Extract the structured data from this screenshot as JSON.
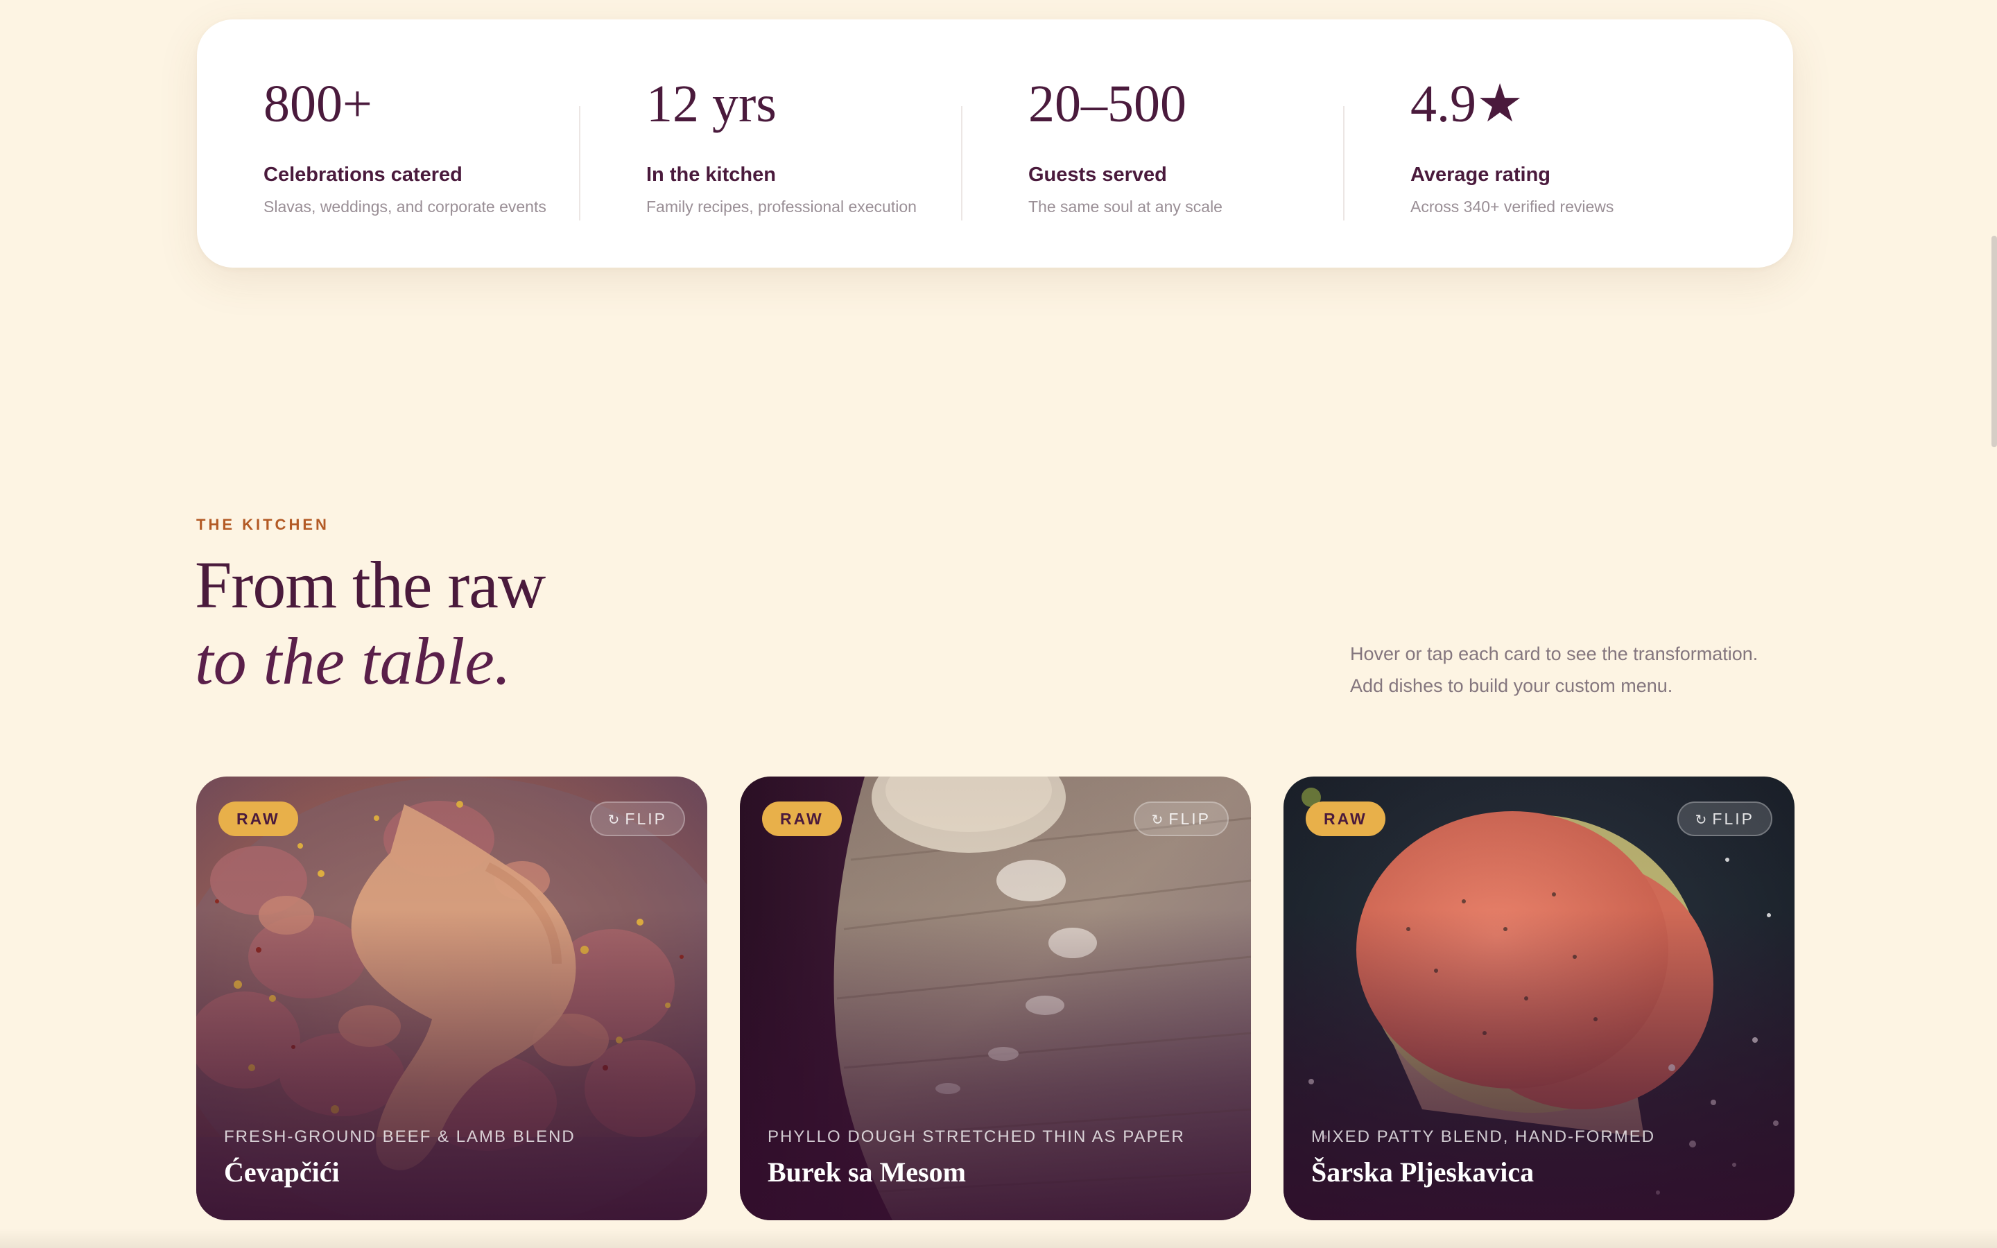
{
  "stats": [
    {
      "value": "800+",
      "label": "Celebrations catered",
      "desc": "Slavas, weddings, and corporate events"
    },
    {
      "value": "12 yrs",
      "label": "In the kitchen",
      "desc": "Family recipes, professional execution"
    },
    {
      "value": "20–500",
      "label": "Guests served",
      "desc": "The same soul at any scale"
    },
    {
      "value": "4.9★",
      "label": "Average rating",
      "desc": "Across 340+ verified reviews"
    }
  ],
  "section": {
    "eyebrow": "THE KITCHEN",
    "title_line1": "From the raw",
    "title_line2": "to the table.",
    "intro_line1": "Hover or tap each card to see the transformation.",
    "intro_line2": "Add dishes to build your custom menu."
  },
  "cards": [
    {
      "badge": "RAW",
      "flip_icon": "↻",
      "flip_label": "FLIP",
      "subtitle": "FRESH-GROUND BEEF & LAMB BLEND",
      "name": "Ćevapčići"
    },
    {
      "badge": "RAW",
      "flip_icon": "↻",
      "flip_label": "FLIP",
      "subtitle": "PHYLLO DOUGH STRETCHED THIN AS PAPER",
      "name": "Burek sa Mesom"
    },
    {
      "badge": "RAW",
      "flip_icon": "↻",
      "flip_label": "FLIP",
      "subtitle": "MIXED PATTY BLEND, HAND-FORMED",
      "name": "Šarska Pljeskavica"
    }
  ],
  "colors": {
    "background": "#fdf4e3",
    "plum": "#4a1a3c",
    "accent_orange": "#b35a25",
    "badge_gold": "#e8b04a"
  }
}
